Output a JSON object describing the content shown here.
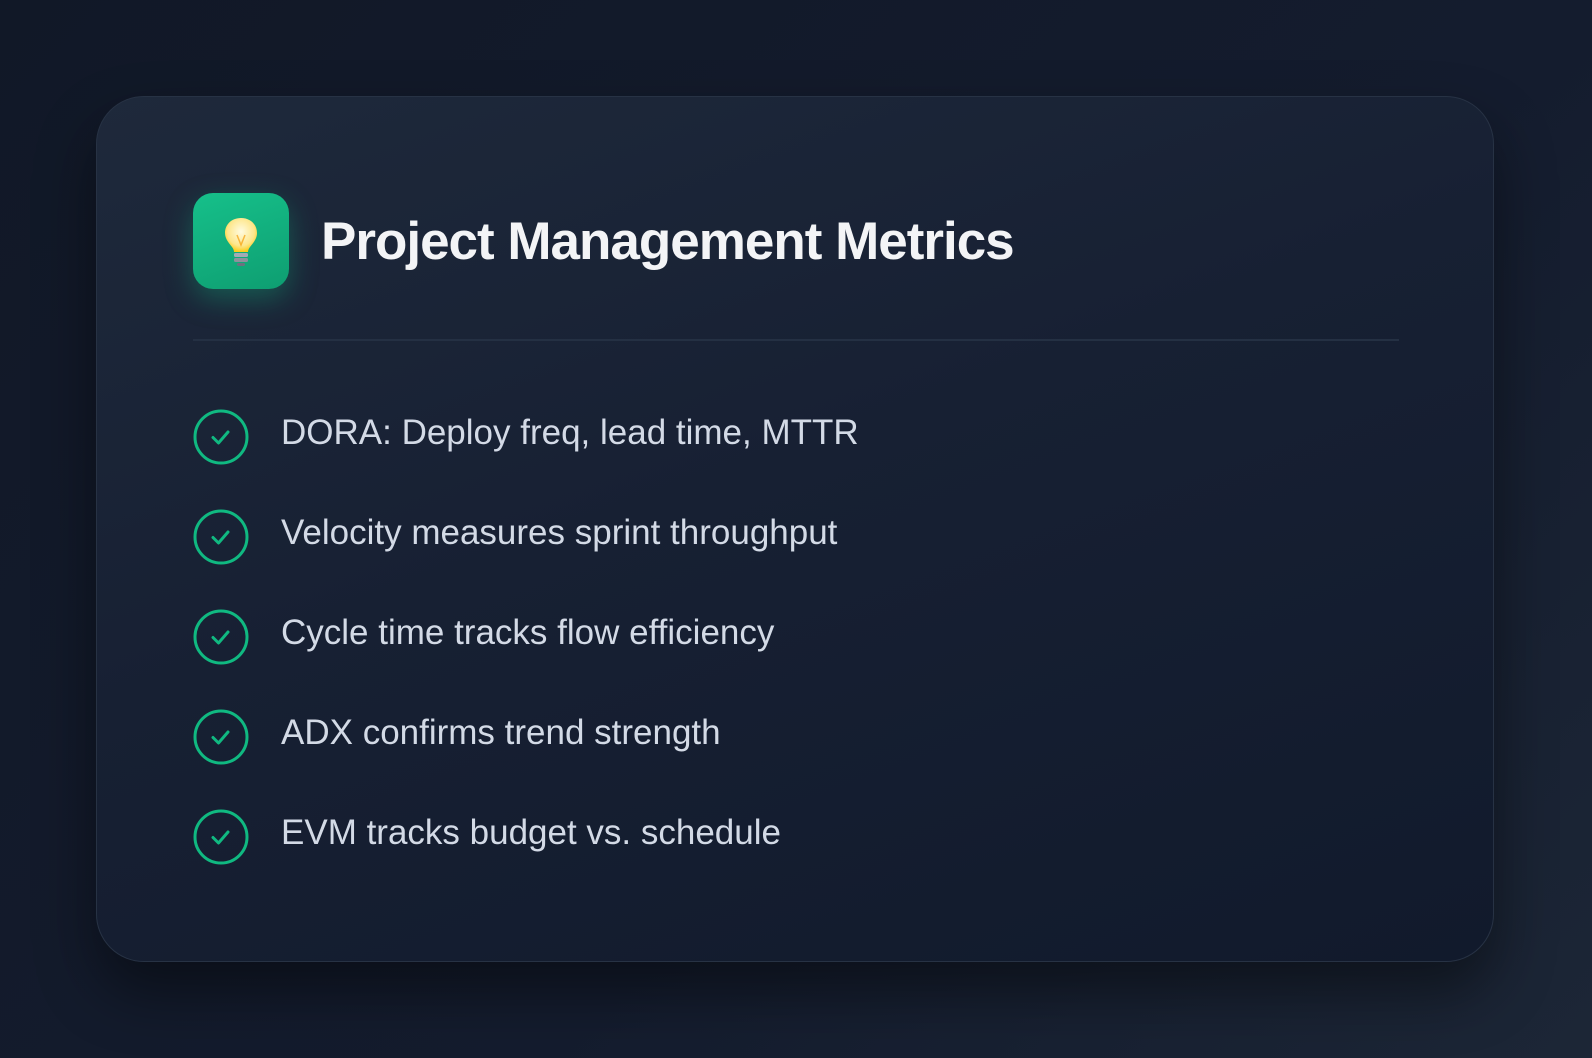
{
  "card": {
    "title": "Project Management Metrics",
    "icon": "lightbulb-icon",
    "items": [
      {
        "text": "DORA: Deploy freq, lead time, MTTR",
        "icon": "check-circle-icon"
      },
      {
        "text": "Velocity measures sprint throughput",
        "icon": "check-circle-icon"
      },
      {
        "text": "Cycle time tracks flow efficiency",
        "icon": "check-circle-icon"
      },
      {
        "text": "ADX confirms trend strength",
        "icon": "check-circle-icon"
      },
      {
        "text": "EVM tracks budget vs. schedule",
        "icon": "check-circle-icon"
      }
    ]
  },
  "colors": {
    "background": "#111827",
    "card": "#1e293b",
    "accent": "#10b981",
    "title": "#f3f4f6",
    "text": "#d3dae6"
  }
}
